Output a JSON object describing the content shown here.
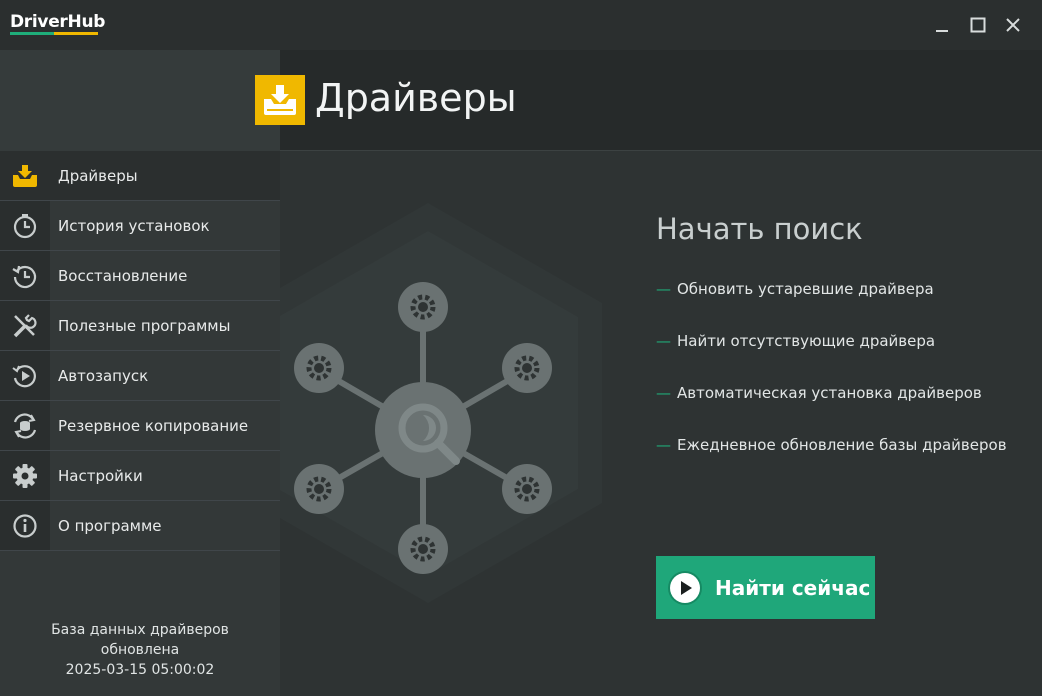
{
  "app": {
    "logo": "DriverHub",
    "logo_colors": [
      "#1fae7a",
      "#f0b800"
    ]
  },
  "window_controls": {
    "minimize_icon": "minimize-icon",
    "maximize_icon": "maximize-icon",
    "close_icon": "close-icon"
  },
  "header": {
    "title": "Драйверы",
    "icon": "driver-tray-icon",
    "icon_color": "#f0b800"
  },
  "sidebar": {
    "items": [
      {
        "label": "Драйверы",
        "icon": "driver-tray-icon",
        "active": true
      },
      {
        "label": "История установок",
        "icon": "clock-icon",
        "active": false
      },
      {
        "label": "Восстановление",
        "icon": "restore-icon",
        "active": false
      },
      {
        "label": "Полезные программы",
        "icon": "tools-icon",
        "active": false
      },
      {
        "label": "Автозапуск",
        "icon": "autostart-icon",
        "active": false
      },
      {
        "label": "Резервное копирование",
        "icon": "backup-icon",
        "active": false
      },
      {
        "label": "Настройки",
        "icon": "gear-icon",
        "active": false
      },
      {
        "label": "О программе",
        "icon": "info-icon",
        "active": false
      }
    ],
    "db_status": {
      "line1": "База данных драйверов",
      "line2": "обновлена",
      "timestamp": "2025-03-15 05:00:02"
    }
  },
  "main": {
    "search_title": "Начать поиск",
    "features": [
      "Обновить устаревшие драйвера",
      "Найти отсутствующие драйвера",
      "Автоматическая установка драйверов",
      "Ежедневное обновление базы драйверов"
    ],
    "cta_label": "Найти сейчас",
    "cta_icon": "play-icon",
    "accent_color": "#1fa77a"
  }
}
